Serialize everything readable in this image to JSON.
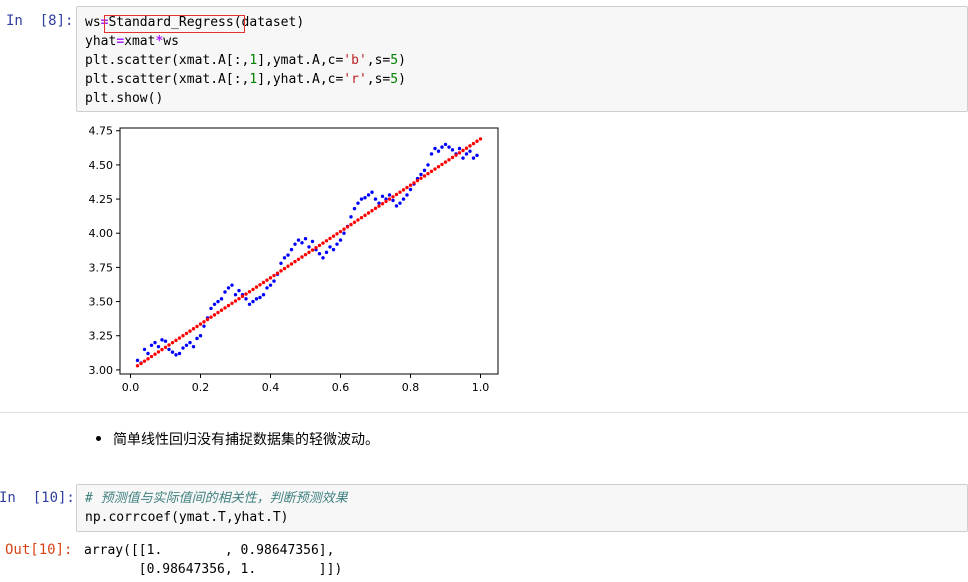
{
  "cell8": {
    "prompt": "In  [8]:",
    "lines": [
      [
        {
          "t": "ws",
          "c": "kw"
        },
        {
          "t": "=",
          "c": "op"
        },
        {
          "t": "Standard_Regress",
          "c": "kw"
        },
        {
          "t": "(dataset)",
          "c": "kw"
        }
      ],
      [
        {
          "t": "yhat",
          "c": "kw"
        },
        {
          "t": "=",
          "c": "op"
        },
        {
          "t": "xmat",
          "c": "kw"
        },
        {
          "t": "*",
          "c": "op"
        },
        {
          "t": "ws",
          "c": "kw"
        }
      ],
      [
        {
          "t": "plt.scatter(xmat.A[:,",
          "c": "kw"
        },
        {
          "t": "1",
          "c": "num"
        },
        {
          "t": "],ymat.A,c=",
          "c": "kw"
        },
        {
          "t": "'b'",
          "c": "str"
        },
        {
          "t": ",s=",
          "c": "kw"
        },
        {
          "t": "5",
          "c": "num"
        },
        {
          "t": ")",
          "c": "kw"
        }
      ],
      [
        {
          "t": "plt.scatter(xmat.A[:,",
          "c": "kw"
        },
        {
          "t": "1",
          "c": "num"
        },
        {
          "t": "],yhat.A,c=",
          "c": "kw"
        },
        {
          "t": "'r'",
          "c": "str"
        },
        {
          "t": ",s=",
          "c": "kw"
        },
        {
          "t": "5",
          "c": "num"
        },
        {
          "t": ")",
          "c": "kw"
        }
      ],
      [
        {
          "t": "plt.show()",
          "c": "kw"
        }
      ]
    ]
  },
  "chart_data": {
    "type": "scatter",
    "title": "",
    "xlabel": "",
    "ylabel": "",
    "xlim": [
      -0.03,
      1.05
    ],
    "ylim": [
      2.97,
      4.77
    ],
    "xticks": [
      "0.0",
      "0.2",
      "0.4",
      "0.6",
      "0.8",
      "1.0"
    ],
    "yticks": [
      "3.00",
      "3.25",
      "3.50",
      "3.75",
      "4.00",
      "4.25",
      "4.50",
      "4.75"
    ],
    "grid": false,
    "series": [
      {
        "color": "#0000ff",
        "points": [
          [
            0.02,
            3.07
          ],
          [
            0.03,
            3.05
          ],
          [
            0.04,
            3.15
          ],
          [
            0.05,
            3.12
          ],
          [
            0.06,
            3.18
          ],
          [
            0.07,
            3.2
          ],
          [
            0.08,
            3.17
          ],
          [
            0.09,
            3.22
          ],
          [
            0.1,
            3.21
          ],
          [
            0.11,
            3.15
          ],
          [
            0.12,
            3.13
          ],
          [
            0.13,
            3.11
          ],
          [
            0.14,
            3.12
          ],
          [
            0.15,
            3.16
          ],
          [
            0.16,
            3.18
          ],
          [
            0.17,
            3.2
          ],
          [
            0.18,
            3.17
          ],
          [
            0.19,
            3.23
          ],
          [
            0.2,
            3.25
          ],
          [
            0.21,
            3.32
          ],
          [
            0.22,
            3.38
          ],
          [
            0.23,
            3.45
          ],
          [
            0.24,
            3.48
          ],
          [
            0.25,
            3.5
          ],
          [
            0.26,
            3.52
          ],
          [
            0.27,
            3.57
          ],
          [
            0.28,
            3.6
          ],
          [
            0.29,
            3.62
          ],
          [
            0.3,
            3.55
          ],
          [
            0.31,
            3.58
          ],
          [
            0.32,
            3.55
          ],
          [
            0.33,
            3.52
          ],
          [
            0.34,
            3.48
          ],
          [
            0.35,
            3.5
          ],
          [
            0.36,
            3.52
          ],
          [
            0.37,
            3.53
          ],
          [
            0.38,
            3.55
          ],
          [
            0.39,
            3.6
          ],
          [
            0.4,
            3.62
          ],
          [
            0.41,
            3.65
          ],
          [
            0.42,
            3.7
          ],
          [
            0.43,
            3.78
          ],
          [
            0.44,
            3.82
          ],
          [
            0.45,
            3.84
          ],
          [
            0.46,
            3.88
          ],
          [
            0.47,
            3.92
          ],
          [
            0.48,
            3.95
          ],
          [
            0.49,
            3.93
          ],
          [
            0.5,
            3.96
          ],
          [
            0.51,
            3.9
          ],
          [
            0.52,
            3.94
          ],
          [
            0.53,
            3.88
          ],
          [
            0.54,
            3.85
          ],
          [
            0.55,
            3.82
          ],
          [
            0.56,
            3.86
          ],
          [
            0.57,
            3.9
          ],
          [
            0.58,
            3.88
          ],
          [
            0.59,
            3.92
          ],
          [
            0.6,
            3.95
          ],
          [
            0.61,
            4.0
          ],
          [
            0.62,
            4.05
          ],
          [
            0.63,
            4.12
          ],
          [
            0.64,
            4.18
          ],
          [
            0.65,
            4.22
          ],
          [
            0.66,
            4.25
          ],
          [
            0.67,
            4.26
          ],
          [
            0.68,
            4.28
          ],
          [
            0.69,
            4.3
          ],
          [
            0.7,
            4.25
          ],
          [
            0.71,
            4.22
          ],
          [
            0.72,
            4.27
          ],
          [
            0.73,
            4.25
          ],
          [
            0.74,
            4.28
          ],
          [
            0.75,
            4.24
          ],
          [
            0.76,
            4.2
          ],
          [
            0.77,
            4.22
          ],
          [
            0.78,
            4.25
          ],
          [
            0.79,
            4.28
          ],
          [
            0.8,
            4.32
          ],
          [
            0.81,
            4.36
          ],
          [
            0.82,
            4.4
          ],
          [
            0.83,
            4.43
          ],
          [
            0.84,
            4.46
          ],
          [
            0.85,
            4.5
          ],
          [
            0.86,
            4.58
          ],
          [
            0.87,
            4.62
          ],
          [
            0.88,
            4.6
          ],
          [
            0.89,
            4.63
          ],
          [
            0.9,
            4.65
          ],
          [
            0.91,
            4.63
          ],
          [
            0.92,
            4.61
          ],
          [
            0.93,
            4.58
          ],
          [
            0.94,
            4.62
          ],
          [
            0.95,
            4.55
          ],
          [
            0.96,
            4.58
          ],
          [
            0.97,
            4.6
          ],
          [
            0.98,
            4.55
          ],
          [
            0.99,
            4.57
          ]
        ]
      },
      {
        "color": "#ff0000",
        "line": {
          "x0": 0.02,
          "y0": 3.03,
          "x1": 1.0,
          "y1": 4.69,
          "n": 99
        }
      }
    ]
  },
  "markdown": {
    "bullet": "简单线性回归没有捕捉数据集的轻微波动。"
  },
  "cell10": {
    "prompt": "In  [10]:",
    "comment": "# 预测值与实际值间的相关性，判断预测效果",
    "line2": "np.corrcoef(ymat.T,yhat.T)",
    "out_prompt": "Out[10]:",
    "out_line1": "array([[1.        , 0.98647356],",
    "out_line2": "       [0.98647356, 1.        ]])"
  }
}
